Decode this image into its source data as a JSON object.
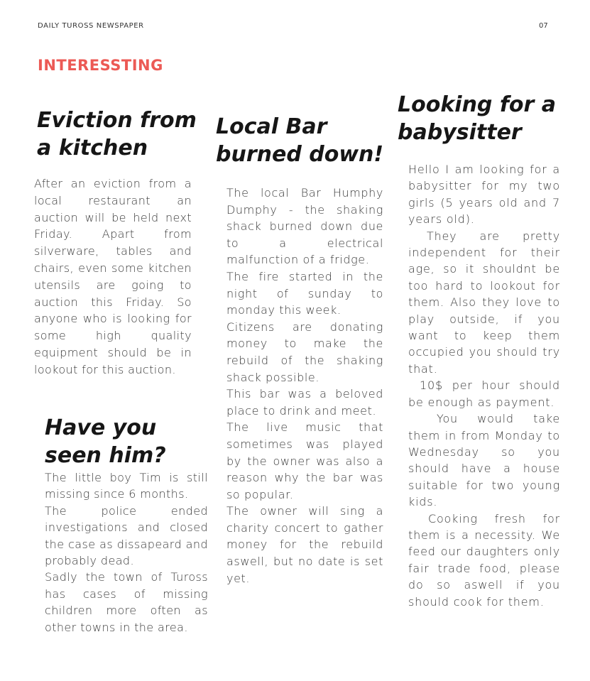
{
  "header": {
    "publication": "DAILY TUROSS NEWSPAPER",
    "page_number": "07"
  },
  "section_title": "INTERESSTING",
  "articles": {
    "eviction": {
      "headline": "Eviction from a kitchen",
      "paragraphs": [
        "After an eviction from a local restaurant an auction will be held next Friday. Apart from silverware, tables and chairs, even some kitchen utensils are going to auction this Friday. So anyone who is looking for some high quality equipment should be in lookout for this auction."
      ]
    },
    "bar": {
      "headline": "Local Bar burned down!",
      "paragraphs": [
        "The local Bar Humphy Dumphy - the shaking shack burned down due to a electrical malfunction of a fridge.",
        "The fire started in the night of sunday to monday this week.",
        "Citizens are donating money to make the rebuild of the shaking shack possible.",
        "This bar was a beloved place to drink and meet.",
        "The live music that sometimes was played by the owner was also a reason why the bar was so popular.",
        "The owner will sing a charity concert to gather money for the rebuild aswell, but no date is set yet."
      ]
    },
    "babysitter": {
      "headline": "Looking for a babysitter",
      "paragraphs": [
        "Hello I am looking for a babysitter for my two girls (5 years old and 7 years old).",
        "They are pretty independent for their age, so it shouldnt be too hard to lookout for them. Also they love to play outside, if you want to keep them occupied you should try that.",
        "10$ per hour should be enough as payment.",
        "You would take them in from Monday to Wednesday so you should have a house suitable for two young kids.",
        "Cooking fresh for them is a necessity. We feed our daughters only fair trade food, please do so aswell if you should cook for them."
      ]
    },
    "missing": {
      "headline": "Have you seen him?",
      "paragraphs": [
        "The little boy Tim is still missing since 6 months.",
        "The police ended investigations and closed the case as dissapeard and probably dead.",
        "Sadly the town of Tuross has cases of missing children more often as other towns in the area."
      ]
    }
  },
  "colors": {
    "accent": "#ec5a55",
    "headline": "#161616",
    "body": "#3a3a3a"
  }
}
